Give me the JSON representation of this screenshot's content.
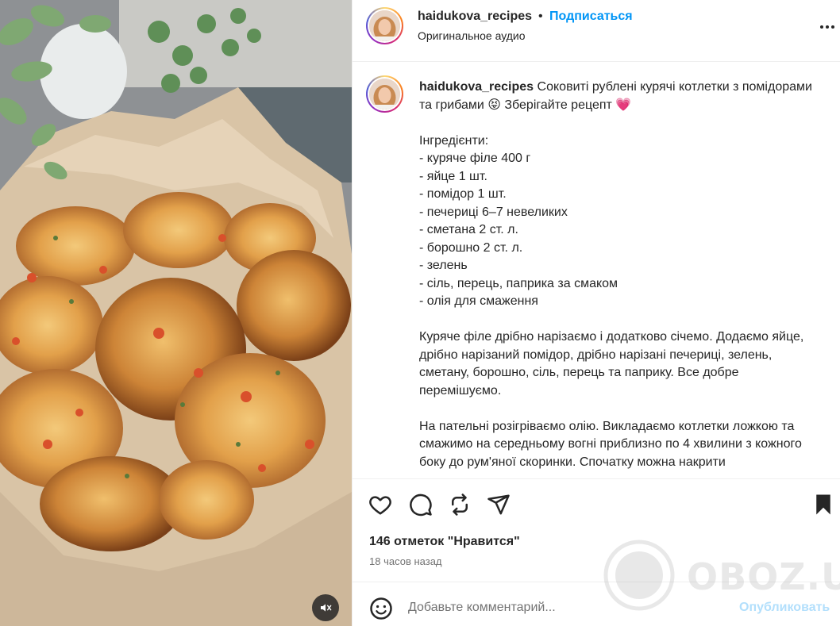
{
  "post": {
    "username": "haidukova_recipes",
    "follow_label": "Подписаться",
    "dot": "•",
    "audio": "Оригинальное аудио",
    "caption_body": "Соковиті рублені курячі котлетки з помідорами та грибами 😝 Зберігайте рецепт 💗\n\nІнгредієнти:\n- куряче філе 400 г\n- яйце 1 шт.\n- помідор 1 шт.\n- печериці 6–7 невеликих\n- сметана 2 ст. л.\n- борошно 2 ст. л.\n- зелень\n- сіль, перець, паприка за смаком\n- олія для смаження\n\nКуряче філе дрібно нарізаємо і додатково січемо. Додаємо яйце, дрібно нарізаний помідор, дрібно нарізані печериці, зелень, сметану, борошно, сіль, перець та паприку. Все добре перемішуємо.\n\nНа пательні розігріваємо олію. Викладаємо котлетки ложкою та смажимо на середньому вогні приблизно по 4 хвилини з кожного боку до рум'яної скоринки. Спочатку можна накрити",
    "likes": "146 отметок \"Нравится\"",
    "time_ago": "18 часов назад"
  },
  "comment": {
    "placeholder": "Добавьте комментарий...",
    "publish_label": "Опубликовать"
  },
  "watermark": {
    "text": "OBOZ.UA"
  },
  "icons": {
    "more": "more-options-icon",
    "like": "heart-icon",
    "comment": "comment-bubble-icon",
    "repost": "repost-icon",
    "share": "share-paper-plane-icon",
    "save": "bookmark-icon",
    "emoji": "emoji-icon",
    "mute": "muted-speaker-icon"
  },
  "colors": {
    "link_blue": "#0095f6",
    "publish_disabled": "#b2dffc",
    "secondary_text": "#737373"
  }
}
